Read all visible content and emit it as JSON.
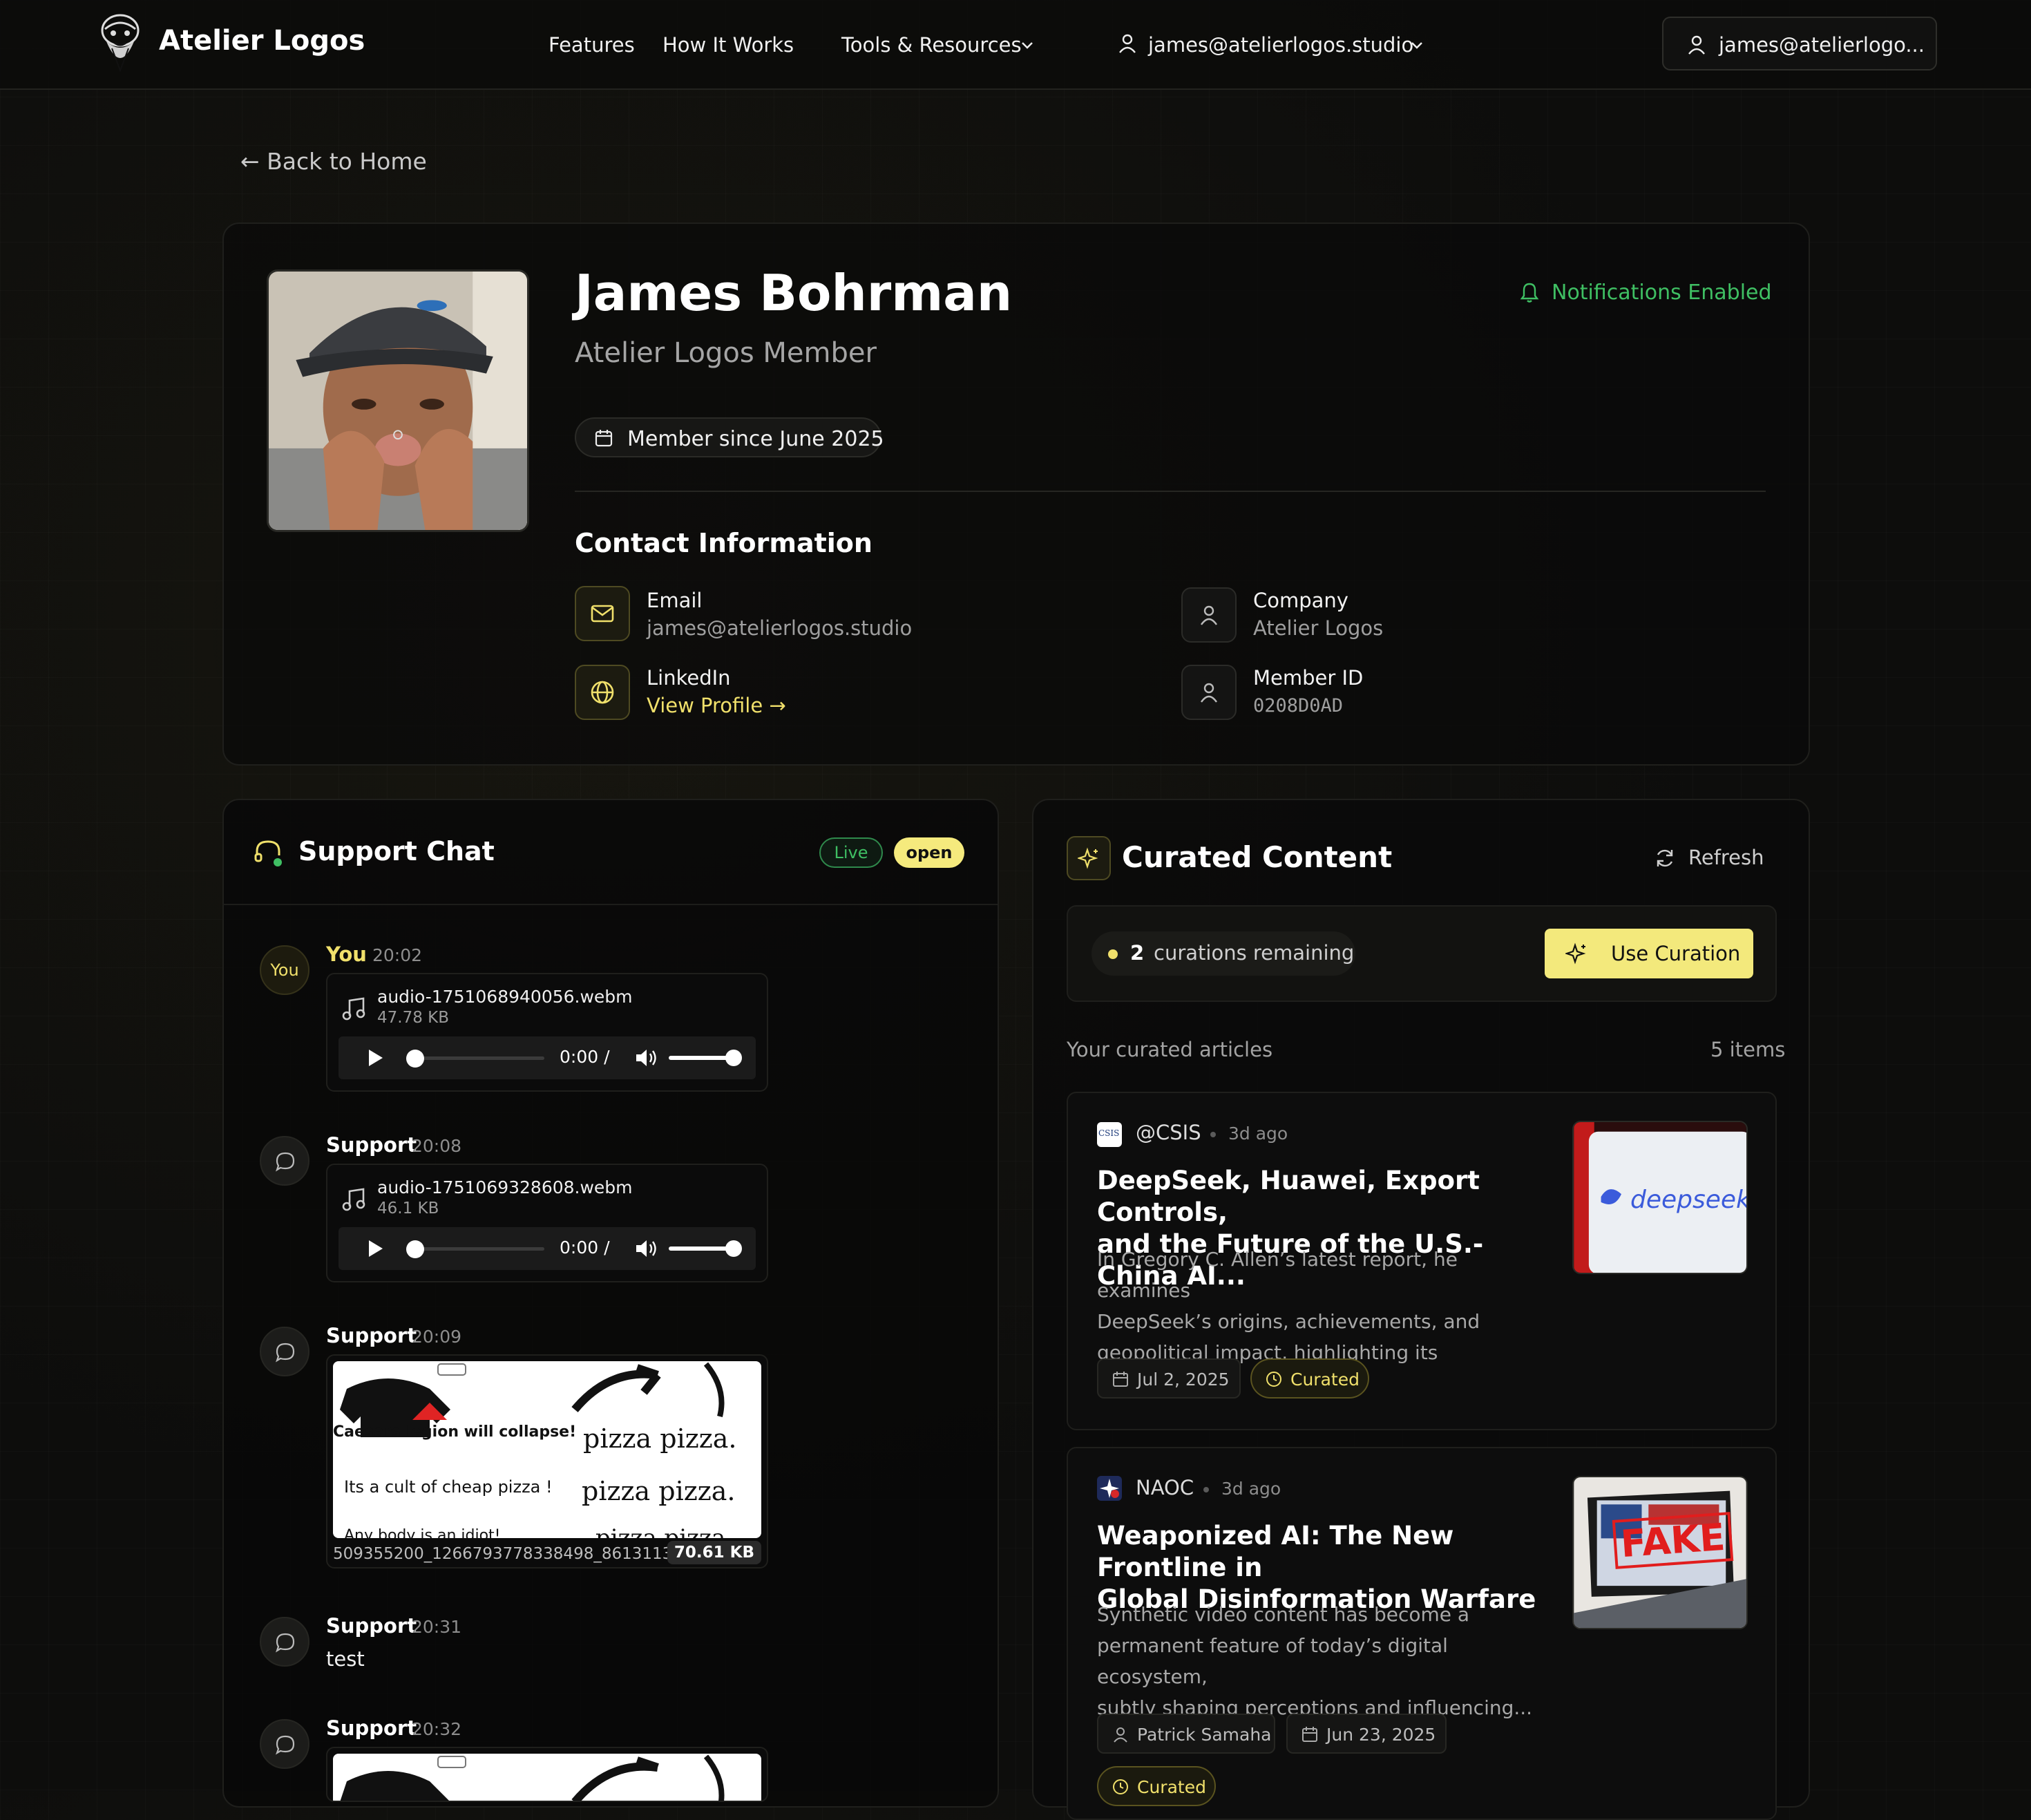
{
  "nav": {
    "brand": "Atelier Logos",
    "links": [
      "Features",
      "How It Works",
      "Tools & Resources"
    ],
    "user_menu": "james@atelierlogos.studio",
    "account_button": "james@atelierlogo..."
  },
  "back_link": "← Back to Home",
  "profile": {
    "name": "James Bohrman",
    "role": "Atelier Logos Member",
    "notifications": "Notifications Enabled",
    "member_since": "Member since June 2025",
    "contact_heading": "Contact Information",
    "email_label": "Email",
    "email_value": "james@atelierlogos.studio",
    "linkedin_label": "LinkedIn",
    "linkedin_value": "View Profile →",
    "company_label": "Company",
    "company_value": "Atelier Logos",
    "member_id_label": "Member ID",
    "member_id_value": "0208D0AD"
  },
  "support_chat": {
    "title": "Support Chat",
    "live_badge": "Live",
    "status_badge": "open",
    "messages": [
      {
        "sender": "You",
        "avatar": "You",
        "time": "20:02",
        "file": "audio-1751068940056.webm",
        "size": "47.78 KB",
        "player_time": "0:00 /"
      },
      {
        "sender": "Support",
        "time": "20:08",
        "file": "audio-1751069328608.webm",
        "size": "46.1 KB",
        "player_time": "0:00 /"
      },
      {
        "sender": "Support",
        "time": "20:09",
        "file": "509355200_1266793778338498_8613113...",
        "size": "70.61 KB",
        "meme": {
          "left_top": "Caesars legion will collapse!",
          "left_mid": "Its a cult of cheap pizza !",
          "left_bottom": "Any body is an idiot!",
          "right_1": "pizza pizza.",
          "right_2": "pizza pizza.",
          "right_3": "pizza pizza"
        }
      },
      {
        "sender": "Support",
        "time": "20:31",
        "text": "test"
      },
      {
        "sender": "Support",
        "time": "20:32"
      }
    ]
  },
  "curated": {
    "title": "Curated Content",
    "refresh": "Refresh",
    "remaining_count": "2",
    "remaining_text": "curations remaining",
    "use_button": "Use Curation",
    "list_label": "Your curated articles",
    "items_count": "5 items",
    "articles": [
      {
        "source": "@CSIS",
        "source_icon_text": "CSIS",
        "ago": "3d ago",
        "title_1": "DeepSeek, Huawei, Export Controls,",
        "title_2": "and the Future of the U.S.-China AI...",
        "desc_1": "In Gregory C. Allen’s latest report, he examines",
        "desc_2": "DeepSeek’s origins, achievements, and",
        "desc_3": "geopolitical impact, highlighting its implications...",
        "date": "Jul 2, 2025",
        "badge": "Curated",
        "thumb_text": "deepseek"
      },
      {
        "source": "NAOC",
        "ago": "3d ago",
        "title_1": "Weaponized AI: The New Frontline in",
        "title_2": "Global Disinformation Warfare",
        "desc_1": "Synthetic video content has become a",
        "desc_2": "permanent feature of today’s digital ecosystem,",
        "desc_3": "subtly shaping perceptions and influencing...",
        "author": "Patrick Samaha",
        "date": "Jun 23, 2025",
        "badge": "Curated",
        "thumb_text": "FAKE"
      }
    ]
  },
  "colors": {
    "accent": "#f0e06b",
    "accent_button": "#f3e97c",
    "success": "#3fbf63",
    "background": "#0d0d0c"
  }
}
